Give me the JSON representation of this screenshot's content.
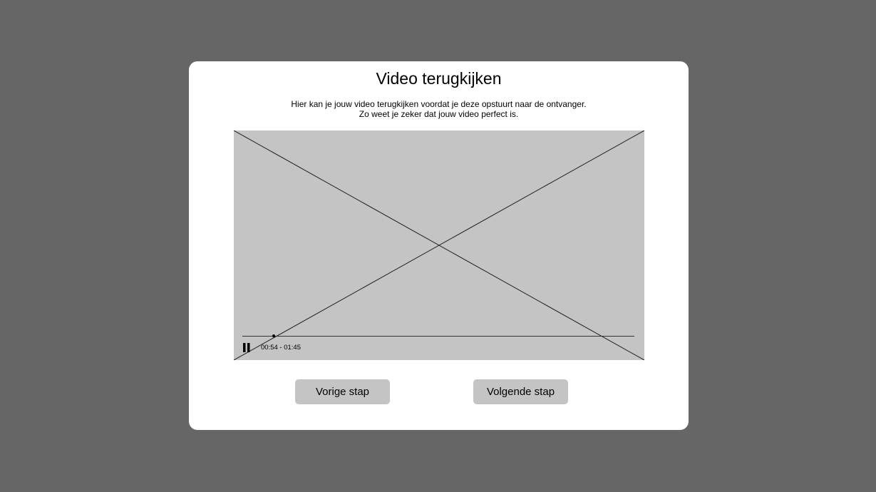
{
  "dialog": {
    "title": "Video terugkijken",
    "description_line1": "Hier kan je jouw video terugkijken voordat je deze opstuurt naar de ontvanger.",
    "description_line2": "Zo weet je zeker dat jouw video perfect is."
  },
  "player": {
    "state_icon": "pause-icon",
    "time_display": "00:54 - 01:45",
    "progress_fraction": 0.08
  },
  "buttons": {
    "previous_label": "Vorige stap",
    "next_label": "Volgende stap"
  }
}
